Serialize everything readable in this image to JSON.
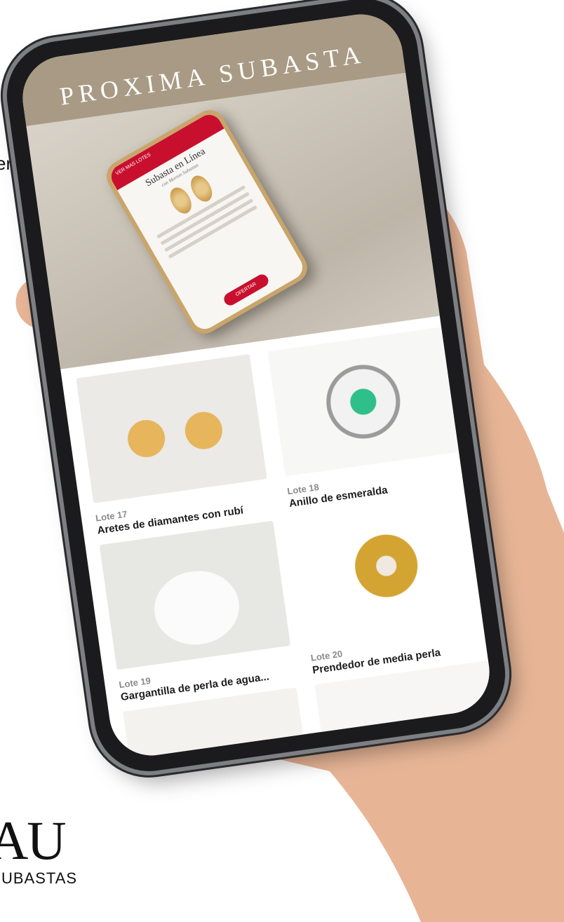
{
  "edge_fragment": "er",
  "brand": {
    "logo_text": "IAU",
    "subtitle": "UBASTAS"
  },
  "banner": {
    "title": "PROXIMA SUBASTA"
  },
  "hero_app": {
    "header_label": "VER MAS LOTES",
    "title": "Subasta en Línea",
    "subtitle": "con Morton Subastas",
    "offer_button": "OFERTAR"
  },
  "lots": [
    {
      "number": "Lote 17",
      "name": "Aretes de diamantes con rubí"
    },
    {
      "number": "Lote 18",
      "name": "Anillo de esmeralda"
    },
    {
      "number": "Lote 19",
      "name": "Gargantilla de perla de agua..."
    },
    {
      "number": "Lote 20",
      "name": "Prendedor de media perla"
    }
  ],
  "colors": {
    "banner": "#a89a84",
    "accent_red": "#c8102e",
    "lot_number": "#8a8a8a"
  }
}
